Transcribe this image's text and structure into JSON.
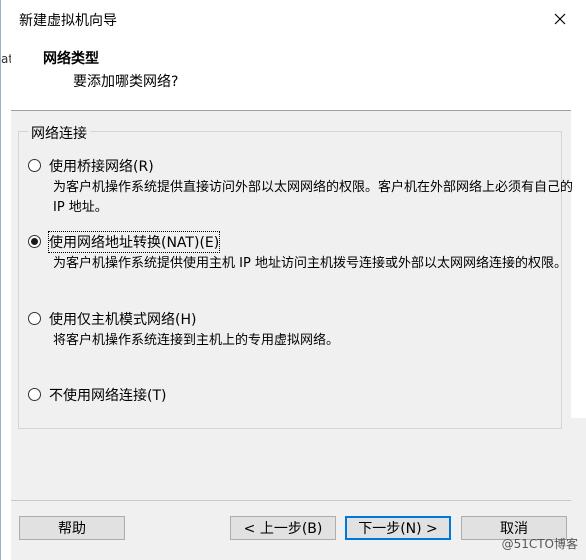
{
  "window": {
    "title": "新建虚拟机向导"
  },
  "header": {
    "title": "网络类型",
    "subtitle": "要添加哪类网络?"
  },
  "background_fragment": "at",
  "group": {
    "legend": "网络连接",
    "options": [
      {
        "label": "使用桥接网络(R)",
        "desc": "为客户机操作系统提供直接访问外部以太网网络的权限。客户机在外部网络上必须有自己的 IP 地址。",
        "checked": false
      },
      {
        "label": "使用网络地址转换(NAT)(E)",
        "desc": "为客户机操作系统提供使用主机 IP 地址访问主机拨号连接或外部以太网网络连接的权限。",
        "checked": true
      },
      {
        "label": "使用仅主机模式网络(H)",
        "desc": "将客户机操作系统连接到主机上的专用虚拟网络。",
        "checked": false
      },
      {
        "label": "不使用网络连接(T)",
        "desc": "",
        "checked": false
      }
    ]
  },
  "buttons": {
    "help": "帮助",
    "back": "< 上一步(B)",
    "next": "下一步(N) >",
    "cancel": "取消"
  },
  "watermark": "@51CTO博客"
}
